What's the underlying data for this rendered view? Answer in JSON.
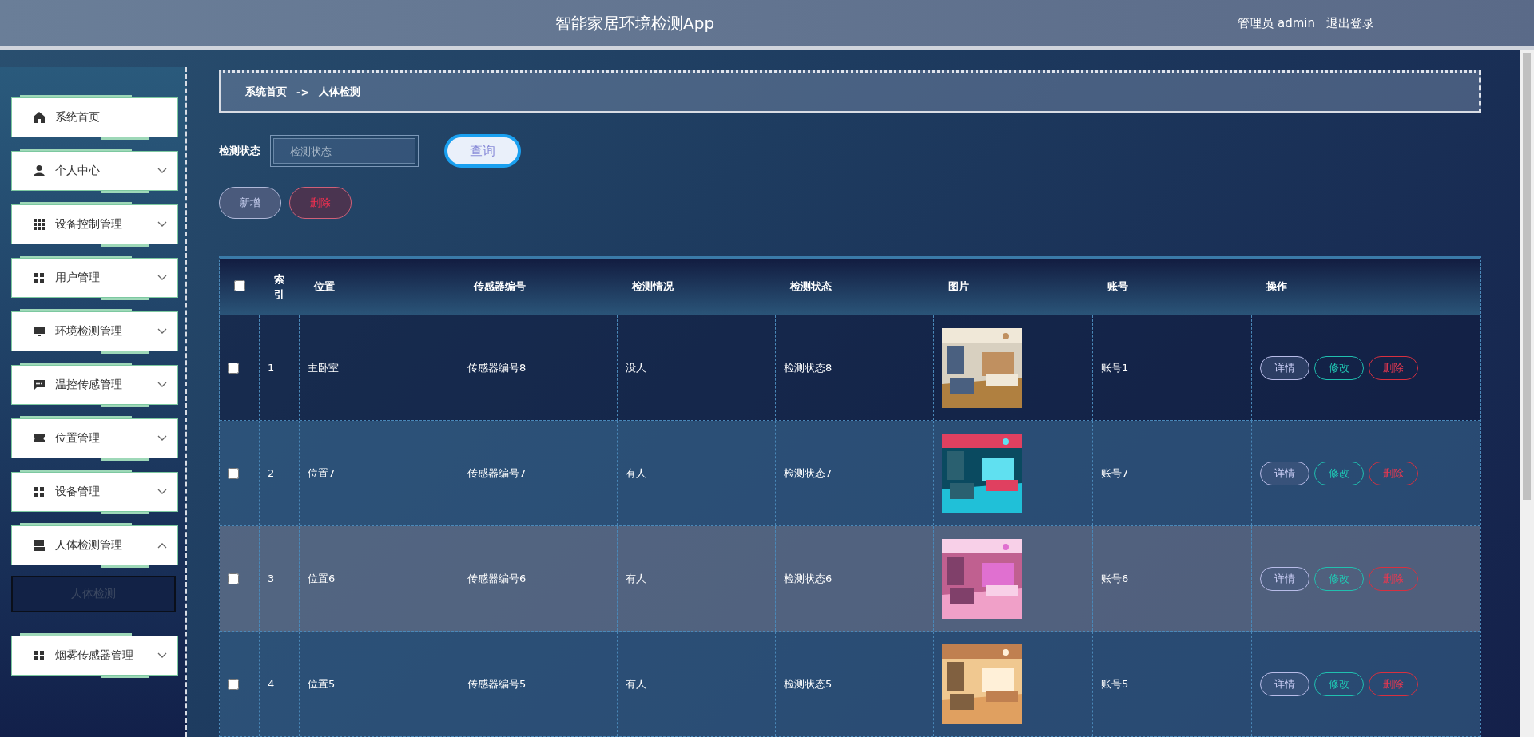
{
  "header": {
    "title": "智能家居环境检测App",
    "user": "管理员 admin",
    "logout": "退出登录"
  },
  "sidebar": {
    "items": [
      {
        "label": "系统首页"
      },
      {
        "label": "个人中心",
        "expanded": false
      },
      {
        "label": "设备控制管理",
        "expanded": false
      },
      {
        "label": "用户管理",
        "expanded": false
      },
      {
        "label": "环境检测管理",
        "expanded": false
      },
      {
        "label": "温控传感管理",
        "expanded": false
      },
      {
        "label": "位置管理",
        "expanded": false
      },
      {
        "label": "设备管理",
        "expanded": false
      },
      {
        "label": "人体检测管理",
        "expanded": true,
        "children": [
          {
            "label": "人体检测",
            "selected": true
          }
        ]
      },
      {
        "label": "烟雾传感器管理",
        "expanded": false
      }
    ]
  },
  "breadcrumb": {
    "home": "系统首页",
    "separator": "->",
    "current": "人体检测"
  },
  "search": {
    "label": "检测状态",
    "placeholder": "检测状态",
    "button": "查询"
  },
  "actions": {
    "add": "新增",
    "delete": "删除"
  },
  "table": {
    "columns": [
      "索引",
      "位置",
      "传感器编号",
      "检测情况",
      "检测状态",
      "图片",
      "账号",
      "操作"
    ],
    "header_checked": false,
    "rows": [
      {
        "checked": false,
        "highlighted": false,
        "index": "1",
        "location": "主卧室",
        "sensor": "传感器编号8",
        "detection": "没人",
        "status": "检测状态8",
        "image": {
          "kind": "picture"
        },
        "account": "账号1",
        "buttons": [
          "详情",
          "修改",
          "删除"
        ]
      },
      {
        "checked": false,
        "highlighted": false,
        "index": "2",
        "location": "位置7",
        "sensor": "传感器编号7",
        "detection": "有人",
        "status": "检测状态7",
        "image": {
          "kind": "picture"
        },
        "account": "账号7",
        "buttons": [
          "详情",
          "修改",
          "删除"
        ]
      },
      {
        "checked": false,
        "highlighted": true,
        "index": "3",
        "location": "位置6",
        "sensor": "传感器编号6",
        "detection": "有人",
        "status": "检测状态6",
        "image": {
          "kind": "picture"
        },
        "account": "账号6",
        "buttons": [
          "详情",
          "修改",
          "删除"
        ]
      },
      {
        "checked": false,
        "highlighted": false,
        "index": "4",
        "location": "位置5",
        "sensor": "传感器编号5",
        "detection": "有人",
        "status": "检测状态5",
        "image": {
          "kind": "picture"
        },
        "account": "账号5",
        "buttons": [
          "详情",
          "修改",
          "删除"
        ]
      }
    ]
  }
}
